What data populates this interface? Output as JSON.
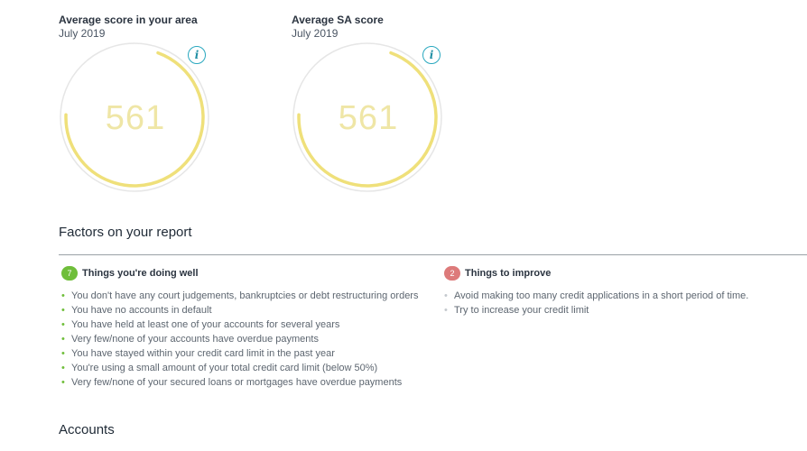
{
  "scores": [
    {
      "title": "Average score in your area",
      "date": "July 2019",
      "value": "561",
      "fill_fraction": 0.7
    },
    {
      "title": "Average SA score",
      "date": "July 2019",
      "value": "561",
      "fill_fraction": 0.7
    }
  ],
  "info_icon_glyph": "i",
  "factors": {
    "title": "Factors on your report",
    "doing_well": {
      "count": "7",
      "label": "Things you're doing well",
      "items": [
        "You don't have any court judgements, bankruptcies or debt restructuring orders",
        "You have no accounts in default",
        "You have held at least one of your accounts for several years",
        "Very few/none of your accounts have overdue payments",
        "You have stayed within your credit card limit in the past year",
        "You're using a small amount of your total credit card limit (below 50%)",
        "Very few/none of your secured loans or mortgages have overdue payments"
      ]
    },
    "to_improve": {
      "count": "2",
      "label": "Things to improve",
      "items": [
        "Avoid making too many credit applications in a short period of time.",
        "Try to increase your credit limit"
      ]
    }
  },
  "accounts": {
    "title": "Accounts"
  },
  "colors": {
    "gauge_fill": "#efe07a",
    "gauge_track": "#e6e6e6",
    "good": "#6fbe3a",
    "bad": "#dd7a7a",
    "info": "#2aa8bf"
  }
}
